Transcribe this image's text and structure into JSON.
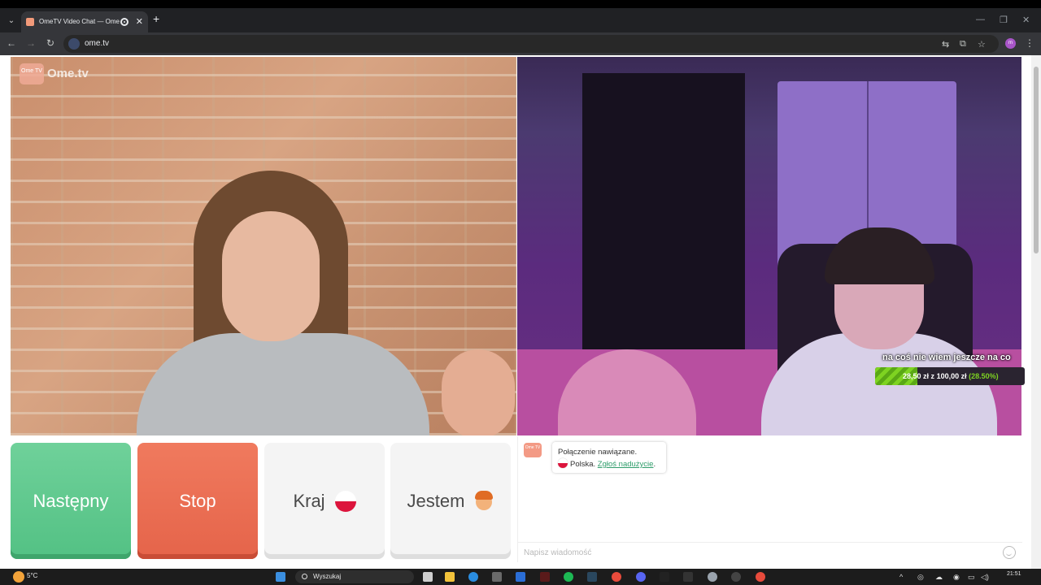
{
  "browser": {
    "tab_title": "OmeTV Video Chat — Ome",
    "close_symbol": "✕",
    "new_tab_symbol": "+",
    "url": "ome.tv",
    "profile_initials": "m",
    "window_controls": [
      "—",
      "❐",
      "✕"
    ]
  },
  "video_left": {
    "logo_badge": "Ome TV",
    "logo_text": "Ome.tv"
  },
  "video_right": {
    "overlay_text": "na coś nie wiem jeszcze na co",
    "goal": {
      "current": "28,50 zł",
      "separator": "z",
      "target": "100,00 zł",
      "percent_label": "(28.50%)",
      "progress": 0.285
    }
  },
  "controls": {
    "next_label": "Następny",
    "stop_label": "Stop",
    "country_label": "Kraj",
    "gender_label": "Jestem"
  },
  "chat": {
    "avatar_label": "Ome TV",
    "connected_text": "Połączenie nawiązane.",
    "country_text": "Polska.",
    "report_text": "Zgłoś nadużycie",
    "input_placeholder": "Napisz wiadomość"
  },
  "taskbar": {
    "temperature": "5°C",
    "search_placeholder": "Wyszukaj",
    "time": "21:51"
  },
  "colors": {
    "next": "#53c184",
    "stop": "#e5644a",
    "goal_fill": "#7ed321",
    "link": "#2f9d6b"
  }
}
